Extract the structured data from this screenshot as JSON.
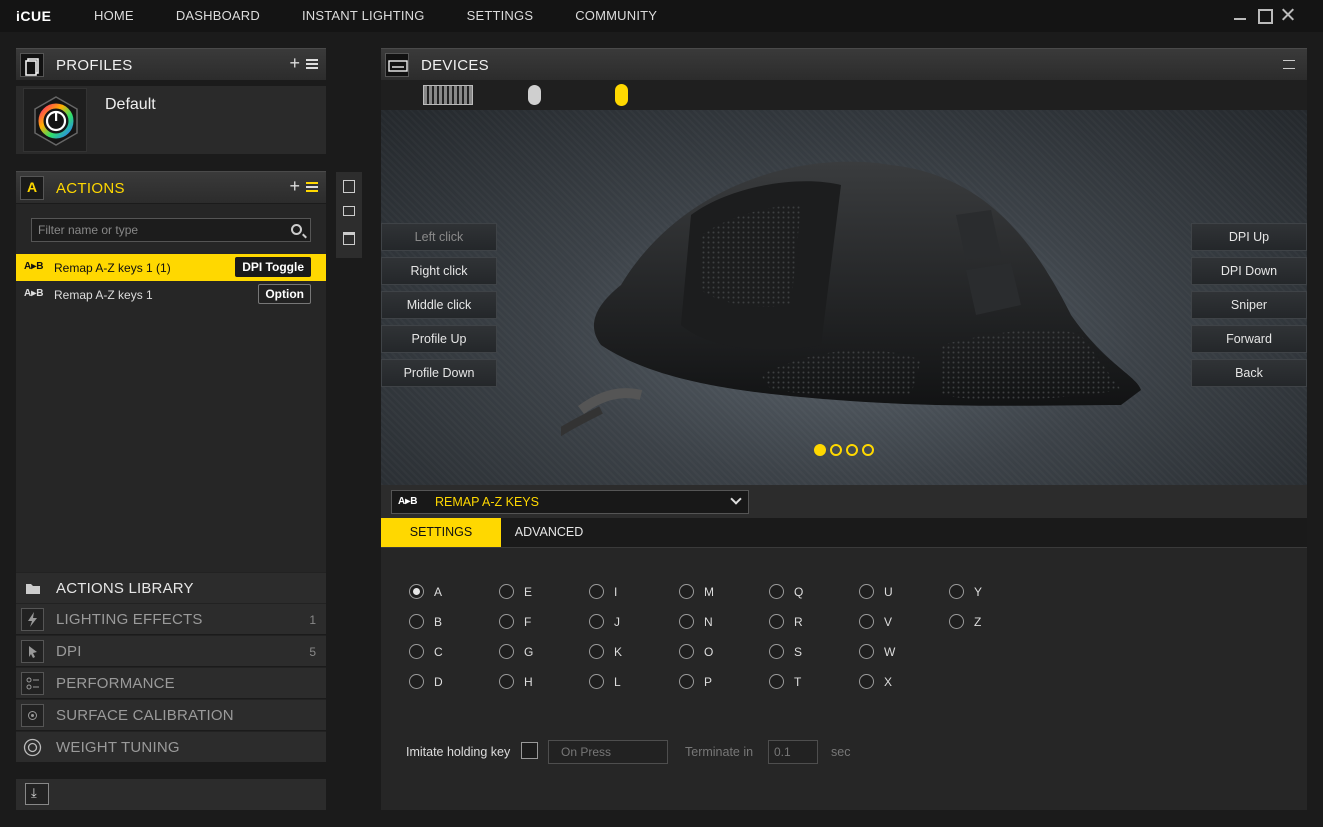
{
  "app": {
    "logo": "iCUE"
  },
  "nav": [
    "HOME",
    "DASHBOARD",
    "INSTANT LIGHTING",
    "SETTINGS",
    "COMMUNITY"
  ],
  "profiles": {
    "title": "PROFILES",
    "current": "Default"
  },
  "actions": {
    "title": "ACTIONS",
    "filter_placeholder": "Filter name or type",
    "items": [
      {
        "tag": "A▸B",
        "name": "Remap A-Z keys 1 (1)",
        "badge": "DPI Toggle",
        "selected": true
      },
      {
        "tag": "A▸B",
        "name": "Remap A-Z keys 1",
        "badge": "Option",
        "selected": false
      }
    ]
  },
  "library": [
    {
      "label": "ACTIONS LIBRARY",
      "count": "",
      "icon": "folder-icon"
    },
    {
      "label": "LIGHTING EFFECTS",
      "count": "1",
      "icon": "lightning-icon"
    },
    {
      "label": "DPI",
      "count": "5",
      "icon": "cursor-icon"
    },
    {
      "label": "PERFORMANCE",
      "count": "",
      "icon": "sliders-icon"
    },
    {
      "label": "SURFACE CALIBRATION",
      "count": "",
      "icon": "crosshair-icon"
    },
    {
      "label": "WEIGHT TUNING",
      "count": "",
      "icon": "weight-icon"
    }
  ],
  "devices": {
    "title": "DEVICES",
    "left_buttons": [
      "Left click",
      "Right click",
      "Middle click",
      "Profile Up",
      "Profile Down"
    ],
    "right_buttons": [
      "DPI Up",
      "DPI Down",
      "Sniper",
      "Forward",
      "Back"
    ],
    "page_dots": 4,
    "active_dot": 0
  },
  "editor": {
    "action_tag": "A▸B",
    "action_type": "REMAP A-Z KEYS",
    "tabs": [
      "SETTINGS",
      "ADVANCED"
    ],
    "active_tab": "SETTINGS",
    "keys": [
      [
        "A",
        "B",
        "C",
        "D"
      ],
      [
        "E",
        "F",
        "G",
        "H"
      ],
      [
        "I",
        "J",
        "K",
        "L"
      ],
      [
        "M",
        "N",
        "O",
        "P"
      ],
      [
        "Q",
        "R",
        "S",
        "T"
      ],
      [
        "U",
        "V",
        "W",
        "X"
      ],
      [
        "Y",
        "Z"
      ]
    ],
    "selected_key": "A",
    "imitate_label": "Imitate holding key",
    "imitate_mode": "On Press",
    "terminate_label": "Terminate in",
    "terminate_value": "0.1",
    "terminate_unit": "sec"
  },
  "colors": {
    "accent": "#ffd800",
    "bg": "#1b1b1b",
    "panel": "#2c2c2c"
  }
}
